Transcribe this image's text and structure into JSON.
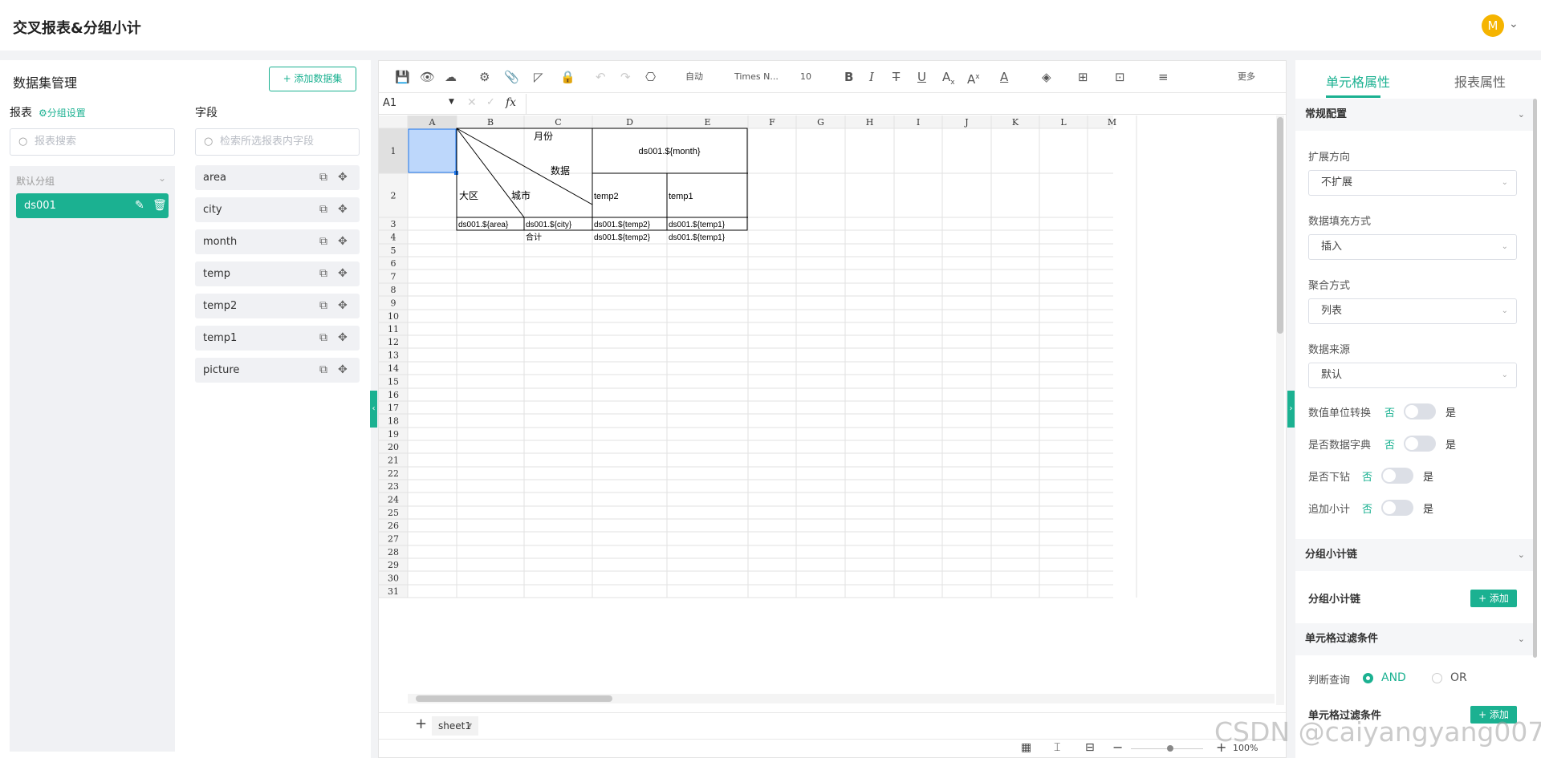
{
  "app": {
    "title": "交叉报表&分组小计",
    "avatar_letter": "M",
    "accent": "#1bb191"
  },
  "left": {
    "title": "数据集管理",
    "add_dataset": "+ 添加数据集",
    "report_label": "报表",
    "group_setting": "分组设置",
    "report_search_placeholder": "报表搜索",
    "field_label": "字段",
    "field_search_placeholder": "检索所选报表内字段",
    "group_name": "默认分组",
    "dataset": "ds001",
    "fields": [
      "area",
      "city",
      "month",
      "temp",
      "temp2",
      "temp1",
      "picture"
    ]
  },
  "toolbar": {
    "auto": "自动",
    "font": "Times N...",
    "size": "10",
    "more": "更多"
  },
  "formula": {
    "cell_ref": "A1",
    "fx": "fx"
  },
  "sheet": {
    "columns": [
      "A",
      "B",
      "C",
      "D",
      "E",
      "F",
      "G",
      "H",
      "I",
      "J",
      "K",
      "L",
      "M"
    ],
    "rows": [
      "1",
      "2",
      "3",
      "4",
      "5",
      "6",
      "7",
      "8",
      "9",
      "10",
      "11",
      "12",
      "13",
      "14",
      "15",
      "16",
      "17",
      "18",
      "19",
      "20",
      "21",
      "22",
      "23",
      "24",
      "25",
      "26",
      "27",
      "28",
      "29",
      "30",
      "31"
    ],
    "cells": {
      "month_header": "月份",
      "data_header": "数据",
      "region_header": "大区",
      "city_header": "城市",
      "d1": "ds001.${month}",
      "d2": "temp2",
      "e2": "temp1",
      "b3": "ds001.${area}",
      "c3": "ds001.${city}",
      "d3": "ds001.${temp2}",
      "e3": "ds001.${temp1}",
      "c4": "合计",
      "d4": "ds001.${temp2}",
      "e4": "ds001.${temp1}"
    },
    "tab": "sheet1",
    "zoom": "100%"
  },
  "right": {
    "tab_cell": "单元格属性",
    "tab_report": "报表属性",
    "sec_general": "常规配置",
    "expand_label": "扩展方向",
    "expand_value": "不扩展",
    "fill_label": "数据填充方式",
    "fill_value": "插入",
    "agg_label": "聚合方式",
    "agg_value": "列表",
    "source_label": "数据来源",
    "source_value": "默认",
    "unit_label": "数值单位转换",
    "dict_label": "是否数据字典",
    "drill_label": "是否下钻",
    "subtotal_label": "追加小计",
    "no": "否",
    "yes": "是",
    "sec_chain": "分组小计链",
    "chain_label": "分组小计链",
    "add": "+ 添加",
    "sec_filter": "单元格过滤条件",
    "judge_label": "判断查询",
    "and": "AND",
    "or": "OR",
    "filter_label": "单元格过滤条件"
  },
  "watermark": "CSDN @caiyangyang007"
}
